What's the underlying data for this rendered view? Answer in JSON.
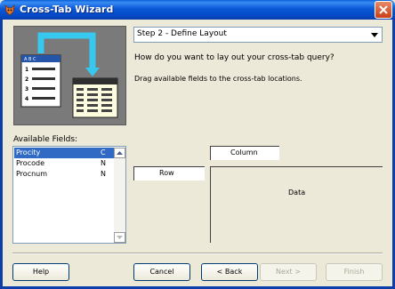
{
  "window": {
    "title": "Cross-Tab Wizard"
  },
  "step": {
    "selected": "Step 2 - Define Layout"
  },
  "question": "How do you want to lay out your cross-tab query?",
  "instruction": "Drag available fields to the cross-tab locations.",
  "available_fields": {
    "label": "Available Fields:",
    "rows": [
      {
        "name": "Procity",
        "type": "C",
        "selected": true
      },
      {
        "name": "Procode",
        "type": "N",
        "selected": false
      },
      {
        "name": "Procnum",
        "type": "N",
        "selected": false
      }
    ]
  },
  "layout": {
    "column_label": "Column",
    "row_label": "Row",
    "data_label": "Data"
  },
  "buttons": {
    "help": "Help",
    "cancel": "Cancel",
    "back": "< Back",
    "next": "Next >",
    "finish": "Finish"
  },
  "illustration": {
    "header_letters": "A B C",
    "row_numbers": [
      "1",
      "2",
      "3",
      "4"
    ]
  },
  "icons": {
    "app": "wizard-fox-icon",
    "close": "close-icon",
    "dropdown": "chevron-down-icon"
  },
  "colors": {
    "title_bar": "#0a58d6",
    "selection": "#316ac5",
    "arrow": "#36c8ee"
  }
}
